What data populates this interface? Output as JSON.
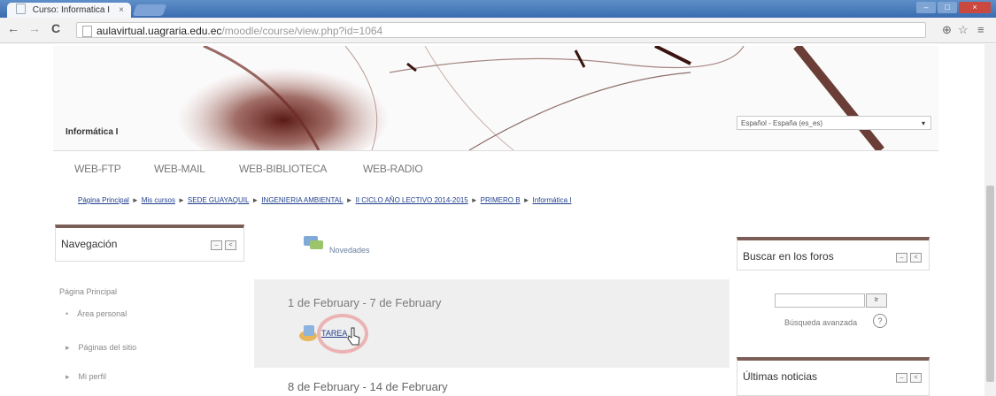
{
  "browser": {
    "tab_title": "Curso: Informatica I",
    "tab_close": "×",
    "url_host": "aulavirtual.uagraria.edu.ec",
    "url_path": "/moodle/course/view.php?id=1064",
    "back_glyph": "←",
    "forward_glyph": "→",
    "reload_glyph": "C",
    "zoom_glyph": "⊕",
    "star_glyph": "☆",
    "menu_glyph": "≡",
    "window_min": "–",
    "window_max": "□",
    "window_close": "×"
  },
  "header": {
    "course_shortname": "Informática I",
    "language_selected": "Español - España (es_es)",
    "language_caret": "▾"
  },
  "links": {
    "ftp": "WEB-FTP",
    "mail": "WEB-MAIL",
    "library": "WEB-BIBLIOTECA",
    "radio": "WEB-RADIO"
  },
  "breadcrumb": [
    "Página Principal",
    "Mis cursos",
    "SEDE GUAYAQUIL",
    "INGENIERIA AMBIENTAL",
    "II CICLO AÑO LECTIVO 2014-2015",
    "PRIMERO B",
    "Informática I"
  ],
  "breadcrumb_sep": "►",
  "nav_block": {
    "title": "Navegación",
    "ctrl_a": "–",
    "ctrl_b": "<",
    "items": [
      {
        "label": "Página Principal",
        "bullet": ""
      },
      {
        "label": "Área personal",
        "bullet": "•"
      },
      {
        "label": "Páginas del sitio",
        "bullet": "▸"
      },
      {
        "label": "Mi perfil",
        "bullet": "▸"
      }
    ]
  },
  "main": {
    "news_label": "Novedades",
    "week1": "1 de February - 7 de February",
    "task_label": "TAREA",
    "week2": "8 de February - 14 de February"
  },
  "search_block": {
    "title": "Buscar en los foros",
    "go_label": "Ir",
    "advanced": "Búsqueda avanzada",
    "help": "?"
  },
  "news_block": {
    "title": "Últimas noticias"
  },
  "colors": {
    "block_border": "#7b5f57",
    "link": "#1f3f8c",
    "tab_bar": "#3a6db1"
  }
}
